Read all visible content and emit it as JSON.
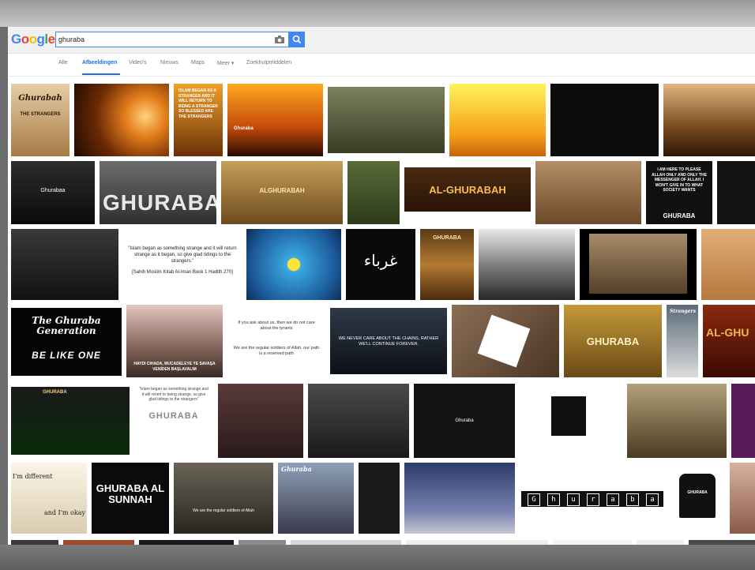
{
  "search": {
    "logo": [
      "G",
      "o",
      "o",
      "g",
      "l",
      "e"
    ],
    "query": "ghuraba"
  },
  "tabs": [
    {
      "label": "Alle"
    },
    {
      "label": "Afbeeldingen",
      "active": true
    },
    {
      "label": "Video's"
    },
    {
      "label": "Nieuws"
    },
    {
      "label": "Maps"
    },
    {
      "label": "Meer ▾"
    },
    {
      "label": "Zoekhulpmiddelen"
    }
  ],
  "tiles": {
    "t1": "Ghurabah",
    "t1b": "THE STRANGERS",
    "t3": "ISLAM BEGAN AS A STRANGER AND IT WILL RETURN TO BEING A STRANGER SO BLESSED ARE THE STRANGERS",
    "t4": "Ghuraba",
    "t10": "Ghurabaa",
    "t11": "GHURABA",
    "t12": "ALGHURABAH",
    "t14": "AL-GHURABAH",
    "t16": "I AM HERE TO PLEASE ALLAH ONLY AND ONLY THE MESSENGER OF ALLAH. I WON'T GIVE IN TO WHAT SOCIETY WANTS",
    "t16b": "GHURABA",
    "t19": "\"Islam began as something strange and it will return strange as it began, so give glad tidings to the strangers.\"",
    "t19b": "[Sahih Muslim Kitab Al-Iman Book 1 Hadith 270]",
    "t21": "غرباء",
    "t22": "GHURABA",
    "t26": "The Ghuraba Generation",
    "t26b": "BE LIKE ONE",
    "t27": "HAYDI CIHADA, MUCADELEYE YE SAVAŞA VENİDEN BAŞLAVALIM",
    "t28": "If you ask about us, then we do not care about the tyrants",
    "t28b": "We are the regular soldiers of Allah, our path is a reserved path",
    "t29": "WE NEVER CARE ABOUT THE CHAINS, RATHER WE'LL CONTINUE FOREVER.",
    "t31": "GHURABA",
    "t32": "Strangers",
    "t33": "AL-GHU",
    "t34": "GHURABA",
    "t35": "\"Islam began as something strange and it will revert to being strange, so give glad tidings to the strangers\"",
    "t35b": "GHURABA",
    "t38": "Ghuraba",
    "t42": "I'm different",
    "t42b": "and I'm okay",
    "t43": "GHURABA AL SUNNAH",
    "t44": "We are the regular soldiers of Allah",
    "t45": "Ghuraba",
    "t48": [
      "G",
      "h",
      "u",
      "r",
      "a",
      "b",
      "a"
    ],
    "t49": "GHURABA"
  }
}
